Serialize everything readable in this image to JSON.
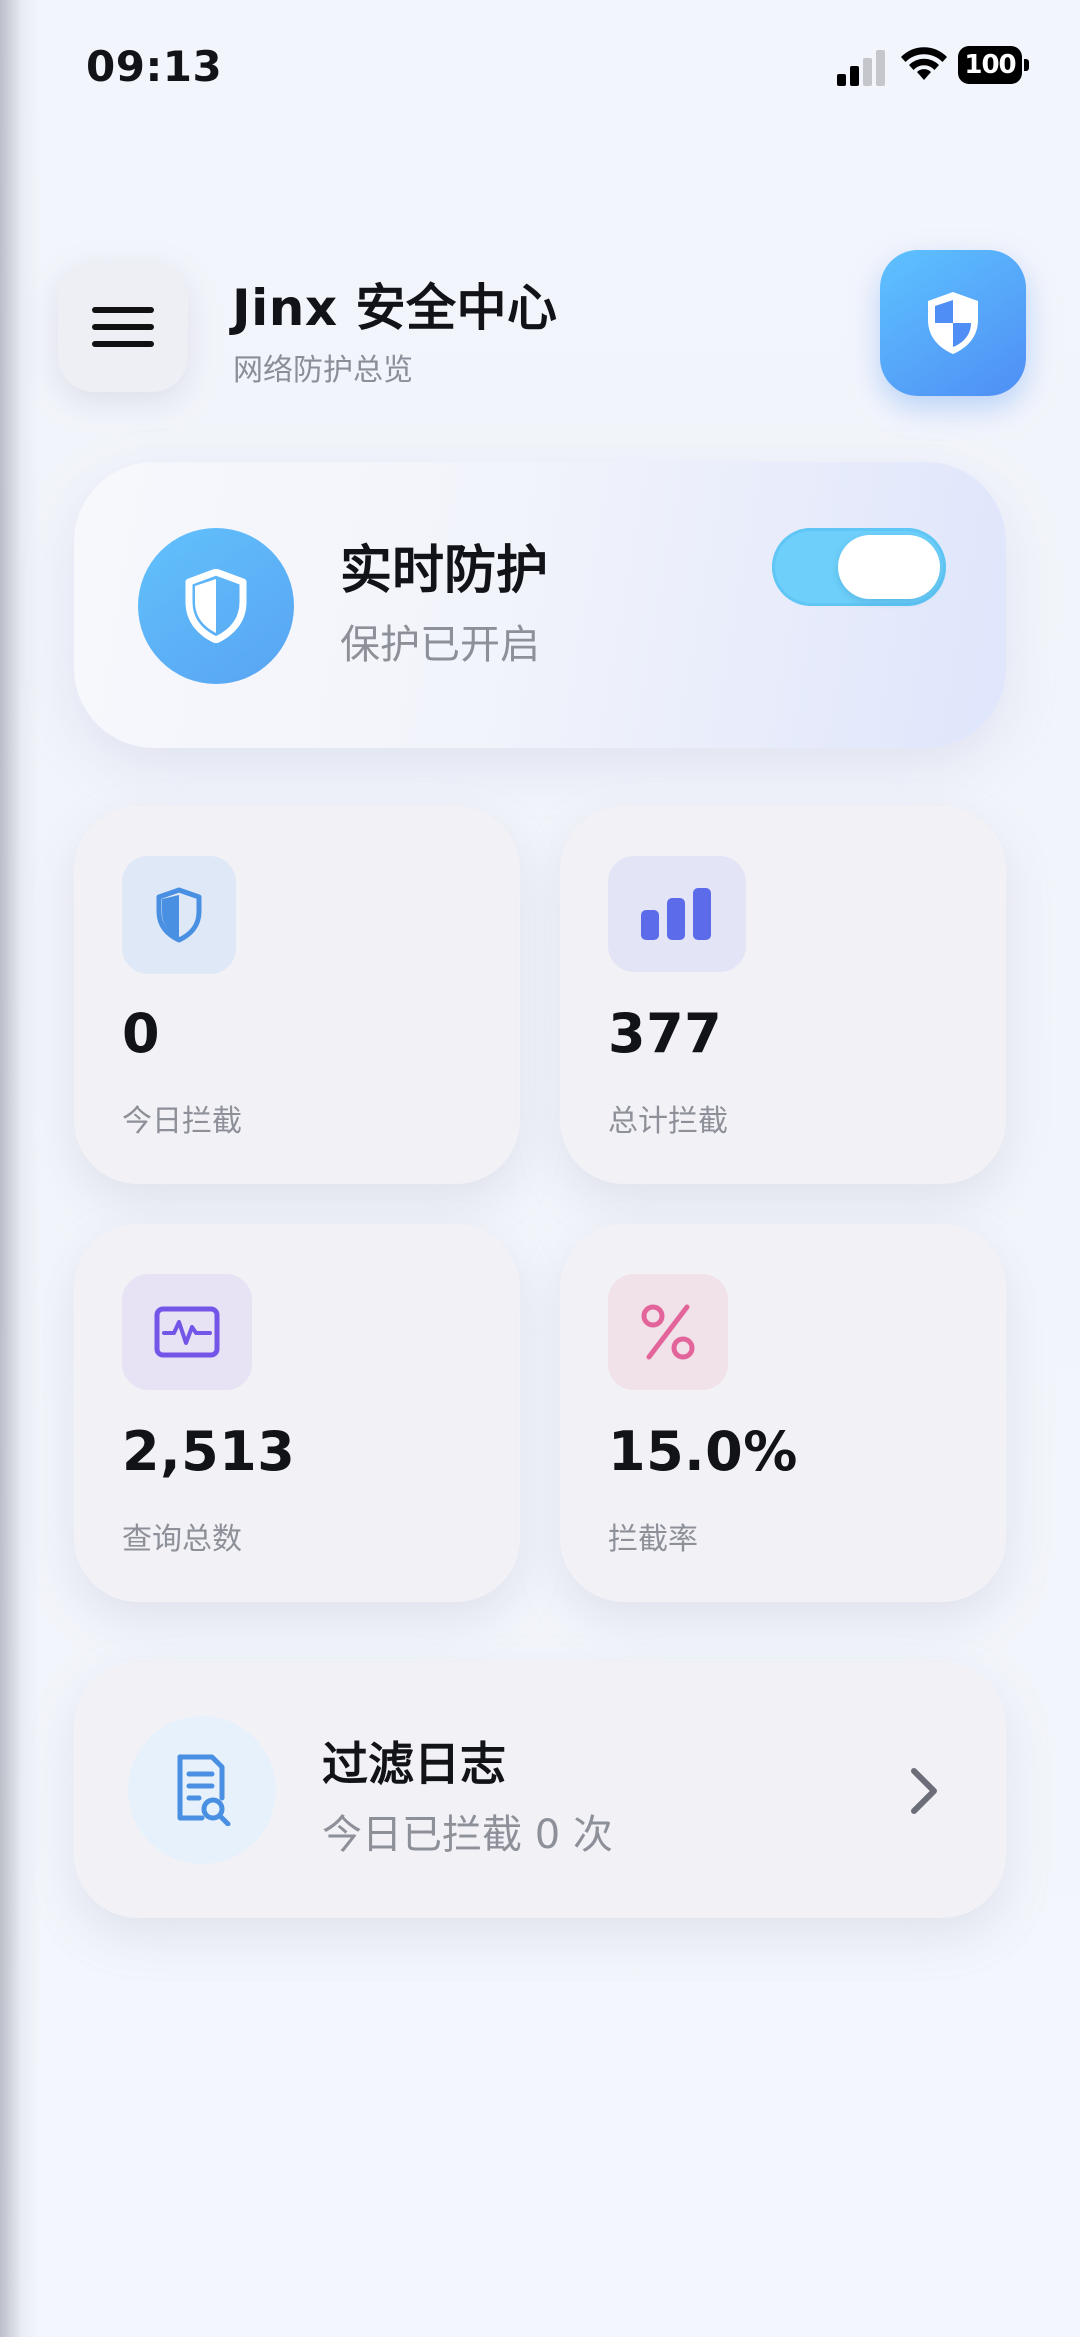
{
  "status_bar": {
    "time": "09:13",
    "battery": "100",
    "icons": [
      "cellular-signal-icon",
      "wifi-icon",
      "battery-icon"
    ]
  },
  "header": {
    "title": "Jinx 安全中心",
    "subtitle": "网络防护总览",
    "menu_icon": "hamburger-menu-icon",
    "shield_icon": "shield-badge-icon"
  },
  "protection": {
    "title": "实时防护",
    "status": "保护已开启",
    "enabled": true,
    "icon": "shield-icon"
  },
  "stats": [
    {
      "value": "0",
      "label": "今日拦截",
      "icon": "shield-icon",
      "accent": "#4a90e2"
    },
    {
      "value": "377",
      "label": "总计拦截",
      "icon": "bar-chart-icon",
      "accent": "#5b6bea"
    },
    {
      "value": "2,513",
      "label": "查询总数",
      "icon": "activity-monitor-icon",
      "accent": "#7356e8"
    },
    {
      "value": "15.0%",
      "label": "拦截率",
      "icon": "percent-icon",
      "accent": "#e2649a"
    }
  ],
  "log": {
    "title": "过滤日志",
    "subtitle": "今日已拦截 0 次",
    "icon": "document-search-icon",
    "chevron": "chevron-right-icon"
  },
  "colors": {
    "background": "#f3f5fc",
    "card": "#f2f2f6",
    "toggle_on": "#6ed0fa",
    "primary_blue": "#4f8ef5",
    "muted_text": "#8e9099"
  }
}
